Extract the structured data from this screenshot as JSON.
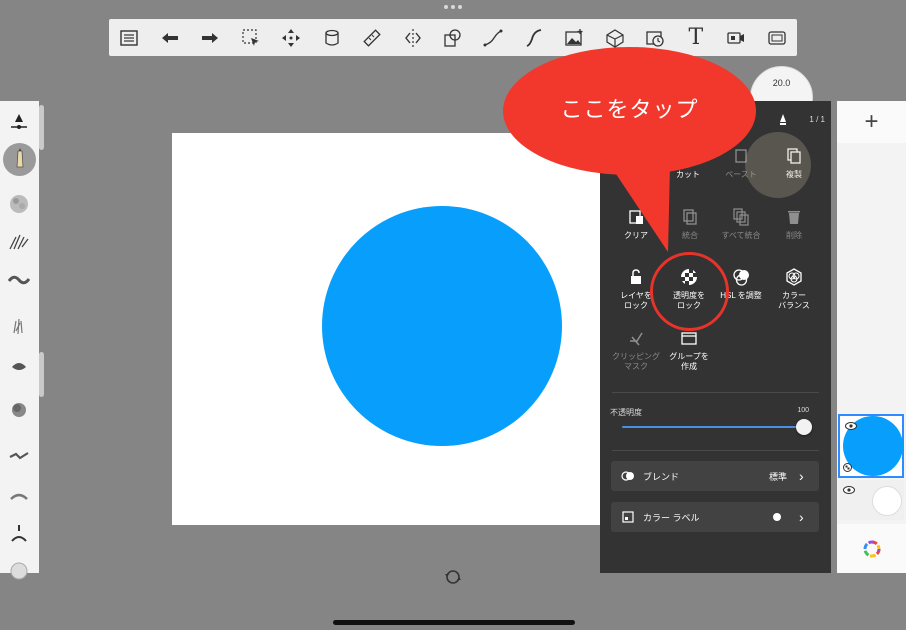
{
  "toolbar": {
    "tools": [
      {
        "name": "layers-list-icon"
      },
      {
        "name": "undo-icon"
      },
      {
        "name": "redo-icon"
      },
      {
        "name": "selection-icon"
      },
      {
        "name": "transform-move-icon"
      },
      {
        "name": "fill-bucket-icon"
      },
      {
        "name": "ruler-icon"
      },
      {
        "name": "symmetry-icon"
      },
      {
        "name": "shape-icon"
      },
      {
        "name": "curve-icon"
      },
      {
        "name": "french-curve-icon"
      },
      {
        "name": "image-import-icon"
      },
      {
        "name": "perspective-icon"
      },
      {
        "name": "time-lapse-icon"
      },
      {
        "name": "text-icon",
        "glyph": "T"
      },
      {
        "name": "video-record-icon"
      },
      {
        "name": "fullscreen-icon"
      }
    ]
  },
  "brush_size": "20.0",
  "menu": {
    "count": "1 / 1",
    "actions": [
      {
        "id": "cut",
        "label": "カット",
        "enabled": true
      },
      {
        "id": "paste",
        "label": "ペースト",
        "enabled": false
      },
      {
        "id": "duplicate",
        "label": "複製",
        "enabled": true
      },
      {
        "id": "clear",
        "label": "クリア",
        "enabled": true
      },
      {
        "id": "merge",
        "label": "統合",
        "enabled": false
      },
      {
        "id": "merge-all",
        "label": "すべて統合",
        "enabled": false
      },
      {
        "id": "delete",
        "label": "削除",
        "enabled": false
      },
      {
        "id": "lock-layer",
        "label": "レイヤを\nロック",
        "enabled": true
      },
      {
        "id": "lock-transparency",
        "label": "透明度を\nロック",
        "enabled": true
      },
      {
        "id": "adjust-hsl",
        "label": "HSL を調整",
        "enabled": true
      },
      {
        "id": "color-balance",
        "label": "カラー\nバランス",
        "enabled": true
      },
      {
        "id": "clipping-mask",
        "label": "クリッピング\nマスク",
        "enabled": false
      },
      {
        "id": "create-group",
        "label": "グループを\n作成",
        "enabled": true
      }
    ],
    "opacity_label": "不透明度",
    "opacity_value": "100",
    "opacity_level": 1.0,
    "blend_label": "ブレンド",
    "blend_value": "標準",
    "color_label_label": "カラー ラベル"
  },
  "callout": {
    "text": "ここをタップ"
  },
  "layers": {
    "add_label": "+"
  },
  "colors": {
    "circle": "#089ffc",
    "callout": "#f2382d",
    "menu_bg": "#333333",
    "slider": "#4a90e2",
    "selected_layer_border": "#2d8cff"
  }
}
